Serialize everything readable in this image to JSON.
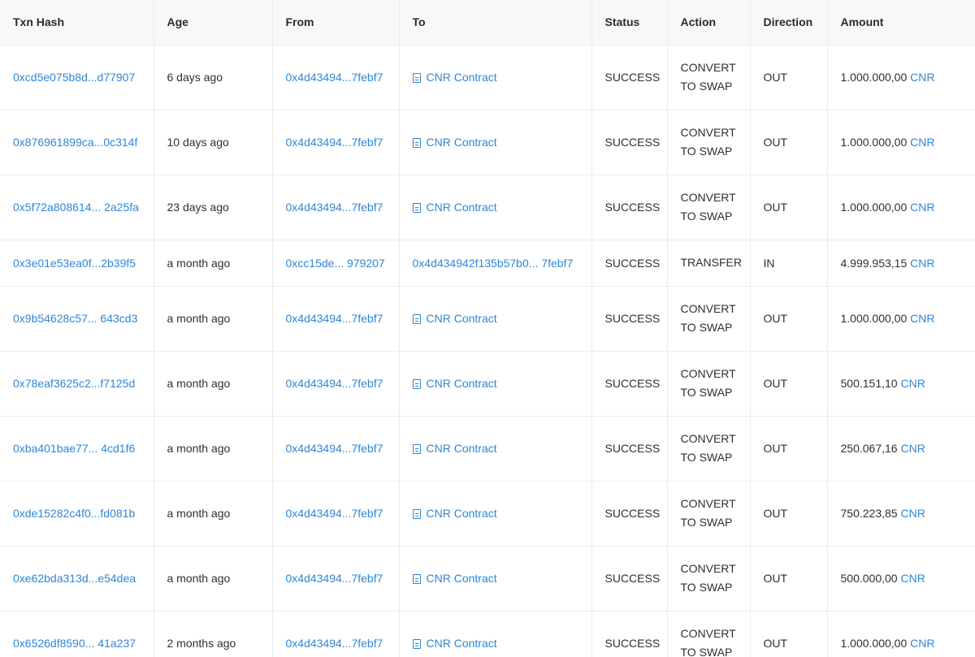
{
  "columns": [
    "Txn Hash",
    "Age",
    "From",
    "To",
    "Status",
    "Action",
    "Direction",
    "Amount"
  ],
  "rows": [
    {
      "hash": "0xcd5e075b8d...d77907",
      "age": "6 days ago",
      "from": "0x4d43494...7febf7",
      "to": "CNR Contract",
      "to_is_contract": true,
      "status": "SUCCESS",
      "action": "CONVERT TO SWAP",
      "direction": "OUT",
      "amount": "1.000.000,00",
      "token": "CNR"
    },
    {
      "hash": "0x876961899ca...0c314f",
      "age": "10 days ago",
      "from": "0x4d43494...7febf7",
      "to": "CNR Contract",
      "to_is_contract": true,
      "status": "SUCCESS",
      "action": "CONVERT TO SWAP",
      "direction": "OUT",
      "amount": "1.000.000,00",
      "token": "CNR"
    },
    {
      "hash": "0x5f72a808614... 2a25fa",
      "age": "23 days ago",
      "from": "0x4d43494...7febf7",
      "to": "CNR Contract",
      "to_is_contract": true,
      "status": "SUCCESS",
      "action": "CONVERT TO SWAP",
      "direction": "OUT",
      "amount": "1.000.000,00",
      "token": "CNR"
    },
    {
      "hash": "0x3e01e53ea0f...2b39f5",
      "age": "a month ago",
      "from": "0xcc15de... 979207",
      "to": "0x4d434942f135b57b0... 7febf7",
      "to_is_contract": false,
      "status": "SUCCESS",
      "action": "TRANSFER",
      "direction": "IN",
      "amount": "4.999.953,15",
      "token": "CNR"
    },
    {
      "hash": "0x9b54628c57... 643cd3",
      "age": "a month ago",
      "from": "0x4d43494...7febf7",
      "to": "CNR Contract",
      "to_is_contract": true,
      "status": "SUCCESS",
      "action": "CONVERT TO SWAP",
      "direction": "OUT",
      "amount": "1.000.000,00",
      "token": "CNR"
    },
    {
      "hash": "0x78eaf3625c2...f7125d",
      "age": "a month ago",
      "from": "0x4d43494...7febf7",
      "to": "CNR Contract",
      "to_is_contract": true,
      "status": "SUCCESS",
      "action": "CONVERT TO SWAP",
      "direction": "OUT",
      "amount": "500.151,10",
      "token": "CNR"
    },
    {
      "hash": "0xba401bae77... 4cd1f6",
      "age": "a month ago",
      "from": "0x4d43494...7febf7",
      "to": "CNR Contract",
      "to_is_contract": true,
      "status": "SUCCESS",
      "action": "CONVERT TO SWAP",
      "direction": "OUT",
      "amount": "250.067,16",
      "token": "CNR"
    },
    {
      "hash": "0xde15282c4f0...fd081b",
      "age": "a month ago",
      "from": "0x4d43494...7febf7",
      "to": "CNR Contract",
      "to_is_contract": true,
      "status": "SUCCESS",
      "action": "CONVERT TO SWAP",
      "direction": "OUT",
      "amount": "750.223,85",
      "token": "CNR"
    },
    {
      "hash": "0xe62bda313d...e54dea",
      "age": "a month ago",
      "from": "0x4d43494...7febf7",
      "to": "CNR Contract",
      "to_is_contract": true,
      "status": "SUCCESS",
      "action": "CONVERT TO SWAP",
      "direction": "OUT",
      "amount": "500.000,00",
      "token": "CNR"
    },
    {
      "hash": "0x6526df8590... 41a237",
      "age": "2 months ago",
      "from": "0x4d43494...7febf7",
      "to": "CNR Contract",
      "to_is_contract": true,
      "status": "SUCCESS",
      "action": "CONVERT TO SWAP",
      "direction": "OUT",
      "amount": "1.000.000,00",
      "token": "CNR"
    }
  ],
  "colors": {
    "link": "#2f86d6",
    "header_bg": "#f8f8f8",
    "border": "#ebebeb"
  },
  "icons": {
    "contract": "document-icon"
  }
}
